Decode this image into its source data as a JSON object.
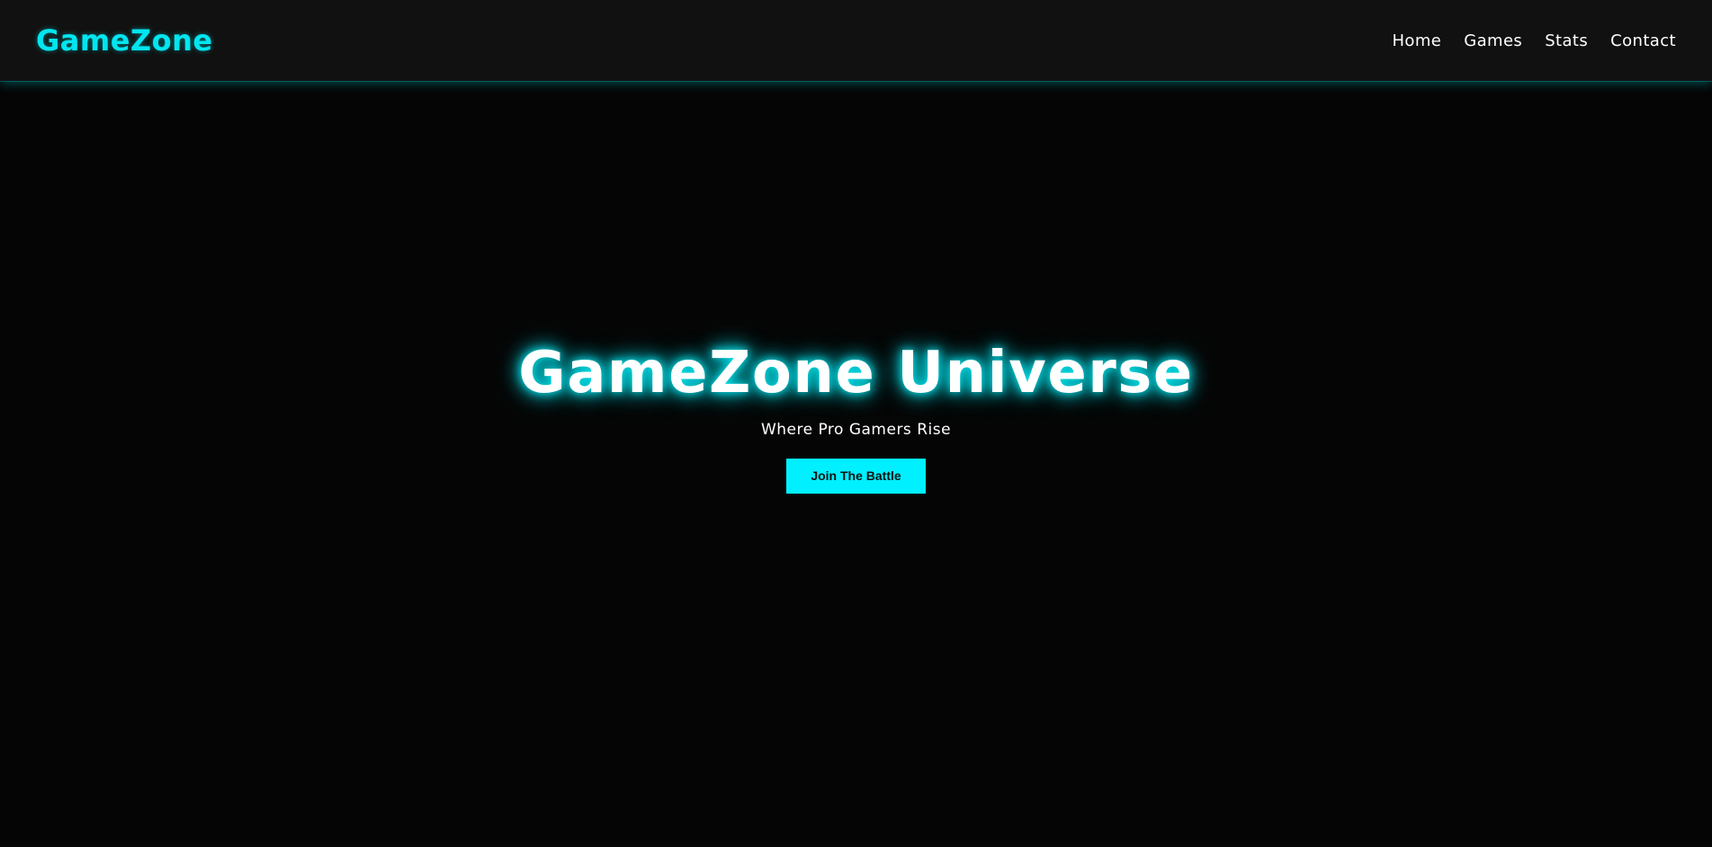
{
  "brand": {
    "logo_text": "GameZone",
    "accent_color": "#00f0ff"
  },
  "nav": {
    "links": [
      {
        "label": "Home"
      },
      {
        "label": "Games"
      },
      {
        "label": "Stats"
      },
      {
        "label": "Contact"
      }
    ]
  },
  "hero": {
    "title": "GameZone Universe",
    "subtitle": "Where Pro Gamers Rise",
    "cta_label": "Join The Battle"
  }
}
